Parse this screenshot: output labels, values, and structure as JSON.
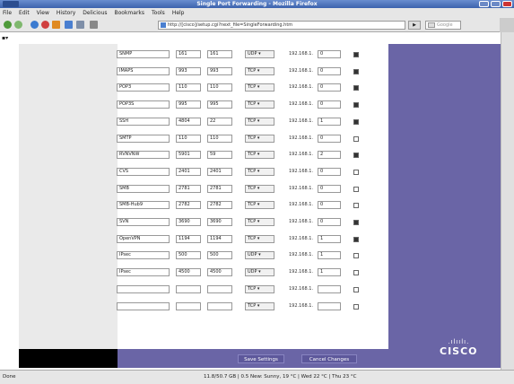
{
  "window": {
    "title": "Single Port Forwarding - Mozilla Firefox"
  },
  "menu": [
    "File",
    "Edit",
    "View",
    "History",
    "Delicious",
    "Bookmarks",
    "Tools",
    "Help"
  ],
  "url": "http://[cisco]/setup.cgi?next_file=SingleForwarding.htm",
  "search_placeholder": "Google",
  "rows": [
    {
      "name": "SNMP",
      "p1": "161",
      "p2": "161",
      "proto": "UDP",
      "ip": "192.168.1.",
      "ipval": "0",
      "on": true
    },
    {
      "name": "IMAPS",
      "p1": "993",
      "p2": "993",
      "proto": "TCP",
      "ip": "192.168.1.",
      "ipval": "0",
      "on": true
    },
    {
      "name": "POP3",
      "p1": "110",
      "p2": "110",
      "proto": "TCP",
      "ip": "192.168.1.",
      "ipval": "0",
      "on": true
    },
    {
      "name": "POP3S",
      "p1": "995",
      "p2": "995",
      "proto": "TCP",
      "ip": "192.168.1.",
      "ipval": "0",
      "on": true
    },
    {
      "name": "SSH",
      "p1": "4804",
      "p2": "22",
      "proto": "TCP",
      "ip": "192.168.1.",
      "ipval": "1",
      "on": true
    },
    {
      "name": "SMTP",
      "p1": "110",
      "p2": "110",
      "proto": "TCP",
      "ip": "192.168.1.",
      "ipval": "0",
      "on": false
    },
    {
      "name": "RVNVNW",
      "p1": "5901",
      "p2": "59",
      "proto": "TCP",
      "ip": "192.168.1.",
      "ipval": "2",
      "on": true
    },
    {
      "name": "CVS",
      "p1": "2401",
      "p2": "2401",
      "proto": "TCP",
      "ip": "192.168.1.",
      "ipval": "0",
      "on": false
    },
    {
      "name": "SMB",
      "p1": "2781",
      "p2": "2781",
      "proto": "TCP",
      "ip": "192.168.1.",
      "ipval": "0",
      "on": false
    },
    {
      "name": "SMB-Hub9",
      "p1": "2782",
      "p2": "2782",
      "proto": "TCP",
      "ip": "192.168.1.",
      "ipval": "0",
      "on": false
    },
    {
      "name": "SVN",
      "p1": "3690",
      "p2": "3690",
      "proto": "TCP",
      "ip": "192.168.1.",
      "ipval": "0",
      "on": true
    },
    {
      "name": "OpenVPN",
      "p1": "1194",
      "p2": "1194",
      "proto": "TCP",
      "ip": "192.168.1.",
      "ipval": "1",
      "on": true
    },
    {
      "name": "IPsec",
      "p1": "500",
      "p2": "500",
      "proto": "UDP",
      "ip": "192.168.1.",
      "ipval": "1",
      "on": false
    },
    {
      "name": "IPsec",
      "p1": "4500",
      "p2": "4500",
      "proto": "UDP",
      "ip": "192.168.1.",
      "ipval": "1",
      "on": false
    },
    {
      "name": "",
      "p1": "",
      "p2": "",
      "proto": "TCP",
      "ip": "192.168.1.",
      "ipval": "",
      "on": false
    },
    {
      "name": "",
      "p1": "",
      "p2": "",
      "proto": "TCP",
      "ip": "192.168.1.",
      "ipval": "",
      "on": false
    }
  ],
  "buttons": {
    "save": "Save Settings",
    "cancel": "Cancel Changes"
  },
  "brand": {
    "bars": ".ılıılı.",
    "word": "CISCO"
  },
  "status": {
    "left": "Done",
    "right": "11.8/50.7 GB  | 0.5  New: Sunny, 19 °C  | Wed 22 °C  | Thu 23 °C"
  },
  "colors": {
    "panel": "#6a65a6",
    "titlebar": "#3c63ad"
  }
}
